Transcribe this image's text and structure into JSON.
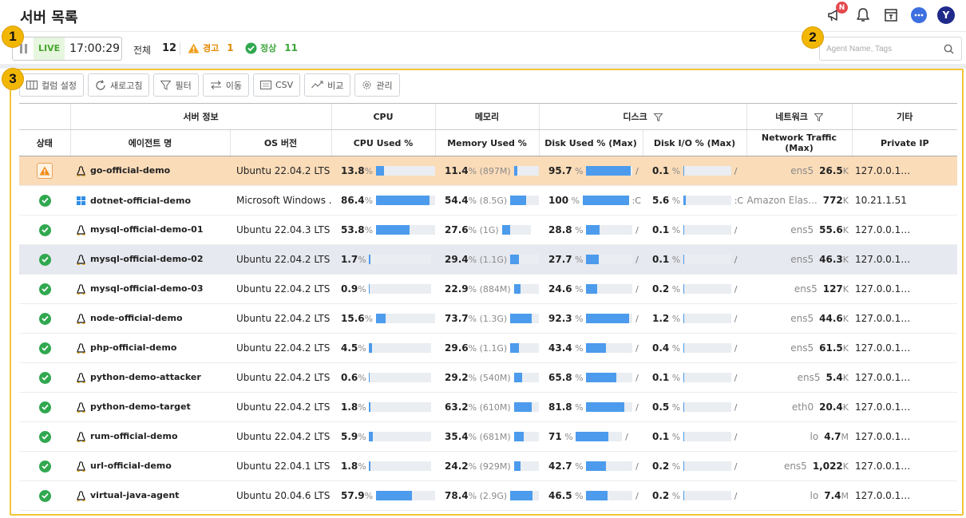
{
  "page": {
    "title": "서버 목록"
  },
  "header_icons": {
    "notice_badge": "N",
    "avatar": "Y"
  },
  "statusbar": {
    "live": "LIVE",
    "time": "17:00:29",
    "total_label": "전체",
    "total": "12",
    "warn_label": "경고",
    "warn_count": "1",
    "ok_label": "정상",
    "ok_count": "11"
  },
  "search": {
    "placeholder": "Agent Name, Tags"
  },
  "markers": [
    "1",
    "2",
    "3"
  ],
  "toolbar": [
    {
      "label": "컬럼 설정",
      "icon": "column-icon"
    },
    {
      "label": "새로고침",
      "icon": "refresh-icon"
    },
    {
      "label": "필터",
      "icon": "filter-icon"
    },
    {
      "label": "이동",
      "icon": "move-icon"
    },
    {
      "label": "CSV",
      "icon": "csv-icon"
    },
    {
      "label": "비교",
      "icon": "compare-icon"
    },
    {
      "label": "관리",
      "icon": "gear-icon"
    }
  ],
  "groups": {
    "server": "서버 정보",
    "cpu": "CPU",
    "memory": "메모리",
    "disk": "디스크",
    "network": "네트워크",
    "etc": "기타"
  },
  "columns": {
    "status": "상태",
    "agent": "에이전트 명",
    "os": "OS 버전",
    "cpu": "CPU Used %",
    "mem": "Memory Used %",
    "disk_used": "Disk Used % (Max)",
    "disk_io": "Disk I/O % (Max)",
    "net": "Network Traffic (Max)",
    "ip": "Private IP"
  },
  "rows": [
    {
      "status": "warn",
      "os_type": "linux",
      "name": "go-official-demo",
      "os": "Ubuntu 22.04.2 LTS",
      "cpu": "13.8",
      "cpu_pct": 13.8,
      "mem": "11.4",
      "mem_sub": "(897M)",
      "mem_pct": 11.4,
      "disk": "95.7",
      "disk_pct": 95.7,
      "disk_mount": "/",
      "io": "0.1",
      "io_pct": 0.1,
      "io_mount": "/",
      "iface": "ens5",
      "net_val": "26.5",
      "net_unit": "K",
      "ip": "127.0.0.1…"
    },
    {
      "status": "ok",
      "os_type": "windows",
      "name": "dotnet-official-demo",
      "os": "Microsoft Windows ...",
      "cpu": "86.4",
      "cpu_pct": 86.4,
      "mem": "54.4",
      "mem_sub": "(8.5G)",
      "mem_pct": 54.4,
      "disk": "100",
      "disk_pct": 100,
      "disk_mount": ":C",
      "io": "5.6",
      "io_pct": 5.6,
      "io_mount": ":C",
      "iface": "Amazon Elas...",
      "net_val": "772",
      "net_unit": "K",
      "ip": "10.21.1.51"
    },
    {
      "status": "ok",
      "os_type": "linux",
      "name": "mysql-official-demo-01",
      "os": "Ubuntu 22.04.3 LTS",
      "cpu": "53.8",
      "cpu_pct": 53.8,
      "mem": "27.6",
      "mem_sub": "(1G)",
      "mem_pct": 27.6,
      "disk": "28.8",
      "disk_pct": 28.8,
      "disk_mount": "/",
      "io": "0.1",
      "io_pct": 0.1,
      "io_mount": "/",
      "iface": "ens5",
      "net_val": "55.6",
      "net_unit": "K",
      "ip": "127.0.0.1…"
    },
    {
      "status": "ok",
      "os_type": "linux",
      "name": "mysql-official-demo-02",
      "os": "Ubuntu 22.04.2 LTS",
      "cpu": "1.7",
      "cpu_pct": 1.7,
      "mem": "29.4",
      "mem_sub": "(1.1G)",
      "mem_pct": 29.4,
      "disk": "27.7",
      "disk_pct": 27.7,
      "disk_mount": "/",
      "io": "0.1",
      "io_pct": 0.1,
      "io_mount": "/",
      "iface": "ens5",
      "net_val": "46.3",
      "net_unit": "K",
      "ip": "127.0.0.1…"
    },
    {
      "status": "ok",
      "os_type": "linux",
      "name": "mysql-official-demo-03",
      "os": "Ubuntu 22.04.2 LTS",
      "cpu": "0.9",
      "cpu_pct": 0.9,
      "mem": "22.9",
      "mem_sub": "(884M)",
      "mem_pct": 22.9,
      "disk": "24.6",
      "disk_pct": 24.6,
      "disk_mount": "/",
      "io": "0.2",
      "io_pct": 0.2,
      "io_mount": "/",
      "iface": "ens5",
      "net_val": "127",
      "net_unit": "K",
      "ip": "127.0.0.1…"
    },
    {
      "status": "ok",
      "os_type": "linux",
      "name": "node-official-demo",
      "os": "Ubuntu 22.04.2 LTS",
      "cpu": "15.6",
      "cpu_pct": 15.6,
      "mem": "73.7",
      "mem_sub": "(1.3G)",
      "mem_pct": 73.7,
      "disk": "92.3",
      "disk_pct": 92.3,
      "disk_mount": "/",
      "io": "1.2",
      "io_pct": 1.2,
      "io_mount": "/",
      "iface": "ens5",
      "net_val": "44.6",
      "net_unit": "K",
      "ip": "127.0.0.1…"
    },
    {
      "status": "ok",
      "os_type": "linux",
      "name": "php-official-demo",
      "os": "Ubuntu 22.04.2 LTS",
      "cpu": "4.5",
      "cpu_pct": 4.5,
      "mem": "29.6",
      "mem_sub": "(1.1G)",
      "mem_pct": 29.6,
      "disk": "43.4",
      "disk_pct": 43.4,
      "disk_mount": "/",
      "io": "0.4",
      "io_pct": 0.4,
      "io_mount": "/",
      "iface": "ens5",
      "net_val": "61.5",
      "net_unit": "K",
      "ip": "127.0.0.1…"
    },
    {
      "status": "ok",
      "os_type": "linux",
      "name": "python-demo-attacker",
      "os": "Ubuntu 22.04.2 LTS",
      "cpu": "0.6",
      "cpu_pct": 0.6,
      "mem": "29.2",
      "mem_sub": "(540M)",
      "mem_pct": 29.2,
      "disk": "65.8",
      "disk_pct": 65.8,
      "disk_mount": "/",
      "io": "0.1",
      "io_pct": 0.1,
      "io_mount": "/",
      "iface": "ens5",
      "net_val": "5.4",
      "net_unit": "K",
      "ip": "127.0.0.1…"
    },
    {
      "status": "ok",
      "os_type": "linux",
      "name": "python-demo-target",
      "os": "Ubuntu 22.04.2 LTS",
      "cpu": "1.8",
      "cpu_pct": 1.8,
      "mem": "63.2",
      "mem_sub": "(610M)",
      "mem_pct": 63.2,
      "disk": "81.8",
      "disk_pct": 81.8,
      "disk_mount": "/",
      "io": "0.5",
      "io_pct": 0.5,
      "io_mount": "/",
      "iface": "eth0",
      "net_val": "20.4",
      "net_unit": "K",
      "ip": "127.0.0.1…"
    },
    {
      "status": "ok",
      "os_type": "linux",
      "name": "rum-official-demo",
      "os": "Ubuntu 22.04.2 LTS",
      "cpu": "5.9",
      "cpu_pct": 5.9,
      "mem": "35.4",
      "mem_sub": "(681M)",
      "mem_pct": 35.4,
      "disk": "71",
      "disk_pct": 71,
      "disk_mount": "/",
      "io": "0.1",
      "io_pct": 0.1,
      "io_mount": "/",
      "iface": "lo",
      "net_val": "4.7",
      "net_unit": "M",
      "ip": "127.0.0.1…"
    },
    {
      "status": "ok",
      "os_type": "linux",
      "name": "url-official-demo",
      "os": "Ubuntu 22.04.1 LTS",
      "cpu": "1.8",
      "cpu_pct": 1.8,
      "mem": "24.2",
      "mem_sub": "(929M)",
      "mem_pct": 24.2,
      "disk": "42.7",
      "disk_pct": 42.7,
      "disk_mount": "/",
      "io": "0.2",
      "io_pct": 0.2,
      "io_mount": "/",
      "iface": "ens5",
      "net_val": "1,022",
      "net_unit": "K",
      "ip": "127.0.0.1…"
    },
    {
      "status": "ok",
      "os_type": "linux",
      "name": "virtual-java-agent",
      "os": "Ubuntu 20.04.6 LTS",
      "cpu": "57.9",
      "cpu_pct": 57.9,
      "mem": "78.4",
      "mem_sub": "(2.9G)",
      "mem_pct": 78.4,
      "disk": "46.5",
      "disk_pct": 46.5,
      "disk_mount": "/",
      "io": "0.2",
      "io_pct": 0.2,
      "io_mount": "/",
      "iface": "lo",
      "net_val": "7.4",
      "net_unit": "M",
      "ip": "127.0.0.1…"
    }
  ],
  "colors": {
    "accent": "#4c9bec",
    "warn": "#e08a00",
    "ok": "#30a84f",
    "highlight": "#fbdcb9",
    "marker": "#f2b705"
  }
}
